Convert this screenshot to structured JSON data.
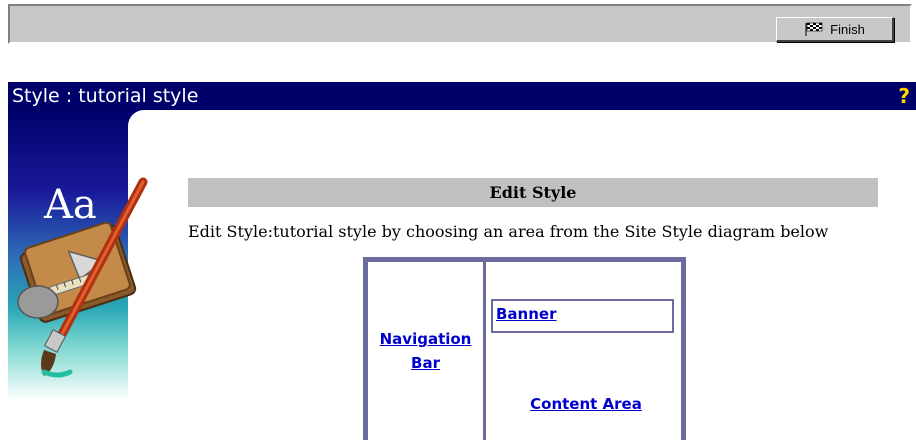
{
  "toolbar": {
    "finish_label": "Finish",
    "finish_icon": "checkered-flag-icon"
  },
  "titlebar": {
    "title": "Style : tutorial style",
    "help": "?"
  },
  "illustration": {
    "icon": "style-paintbrush-icon",
    "text": "Aa"
  },
  "main": {
    "section_header": "Edit Style",
    "instruction": "Edit Style:tutorial style by choosing an area from the Site Style diagram below"
  },
  "diagram": {
    "nav_line1": "Navigation",
    "nav_line2": "Bar",
    "banner": "Banner",
    "content_area": "Content Area"
  },
  "colors": {
    "titlebar_bg": "#00006b",
    "help_icon": "#ffd700",
    "link": "#0000cc",
    "diagram_border": "#6b6ba0",
    "header_bg": "#c0c0c0"
  }
}
